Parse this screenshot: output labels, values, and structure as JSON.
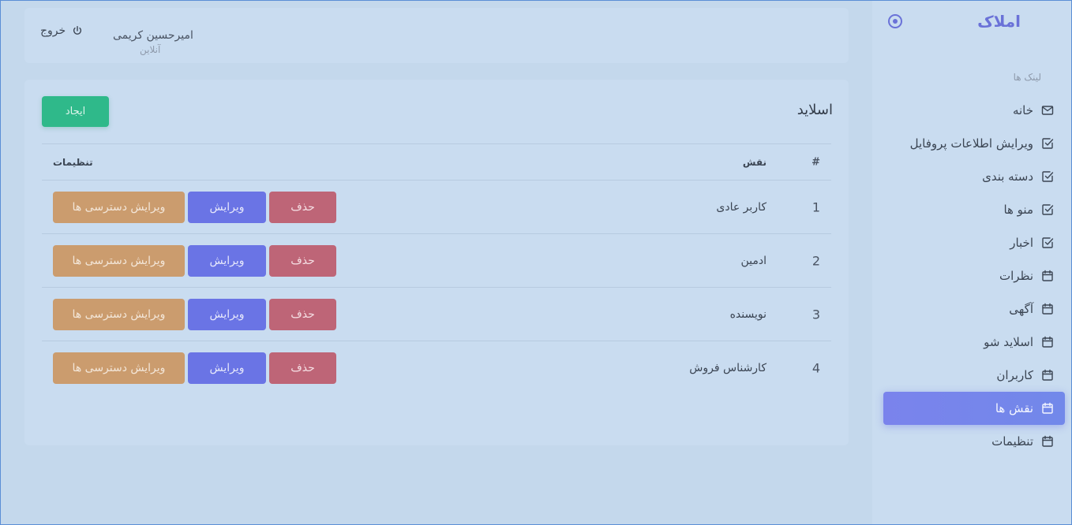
{
  "brand": {
    "title": "املاک",
    "icon": "target-icon"
  },
  "sidebar": {
    "heading": "لینک ها",
    "items": [
      {
        "label": "خانه",
        "icon": "mail-icon",
        "active": false
      },
      {
        "label": "ویرایش اطلاعات پروفایل",
        "icon": "checkbox-icon",
        "active": false
      },
      {
        "label": "دسته بندی",
        "icon": "checkbox-icon",
        "active": false
      },
      {
        "label": "منو ها",
        "icon": "checkbox-icon",
        "active": false
      },
      {
        "label": "اخبار",
        "icon": "checkbox-icon",
        "active": false
      },
      {
        "label": "نظرات",
        "icon": "calendar-icon",
        "active": false
      },
      {
        "label": "آگهی",
        "icon": "calendar-icon",
        "active": false
      },
      {
        "label": "اسلاید شو",
        "icon": "calendar-icon",
        "active": false
      },
      {
        "label": "کاربران",
        "icon": "calendar-icon",
        "active": false
      },
      {
        "label": "نقش ها",
        "icon": "calendar-icon",
        "active": true
      },
      {
        "label": "تنظیمات",
        "icon": "calendar-icon",
        "active": false
      }
    ]
  },
  "header": {
    "logout_label": "خروج",
    "logout_icon": "power-icon",
    "user_name": "امیرحسین کریمی",
    "user_status": "آنلاین"
  },
  "main": {
    "title": "اسلاید",
    "create_label": "ایجاد",
    "table": {
      "columns": {
        "num": "#",
        "role": "نقش",
        "settings": "تنظیمات"
      },
      "rows": [
        {
          "num": "1",
          "role": "کاربر عادی"
        },
        {
          "num": "2",
          "role": "ادمین"
        },
        {
          "num": "3",
          "role": "نویسنده"
        },
        {
          "num": "4",
          "role": "کارشناس فروش"
        }
      ],
      "actions": {
        "delete": "حذف",
        "edit": "ویرایش",
        "permissions": "ویرایش دسترسی ها"
      }
    }
  },
  "colors": {
    "accent": "#6a72d8",
    "create": "#2fb98a",
    "edit": "#6a74e5",
    "delete": "#be6577",
    "permissions": "#cb9c6e"
  }
}
